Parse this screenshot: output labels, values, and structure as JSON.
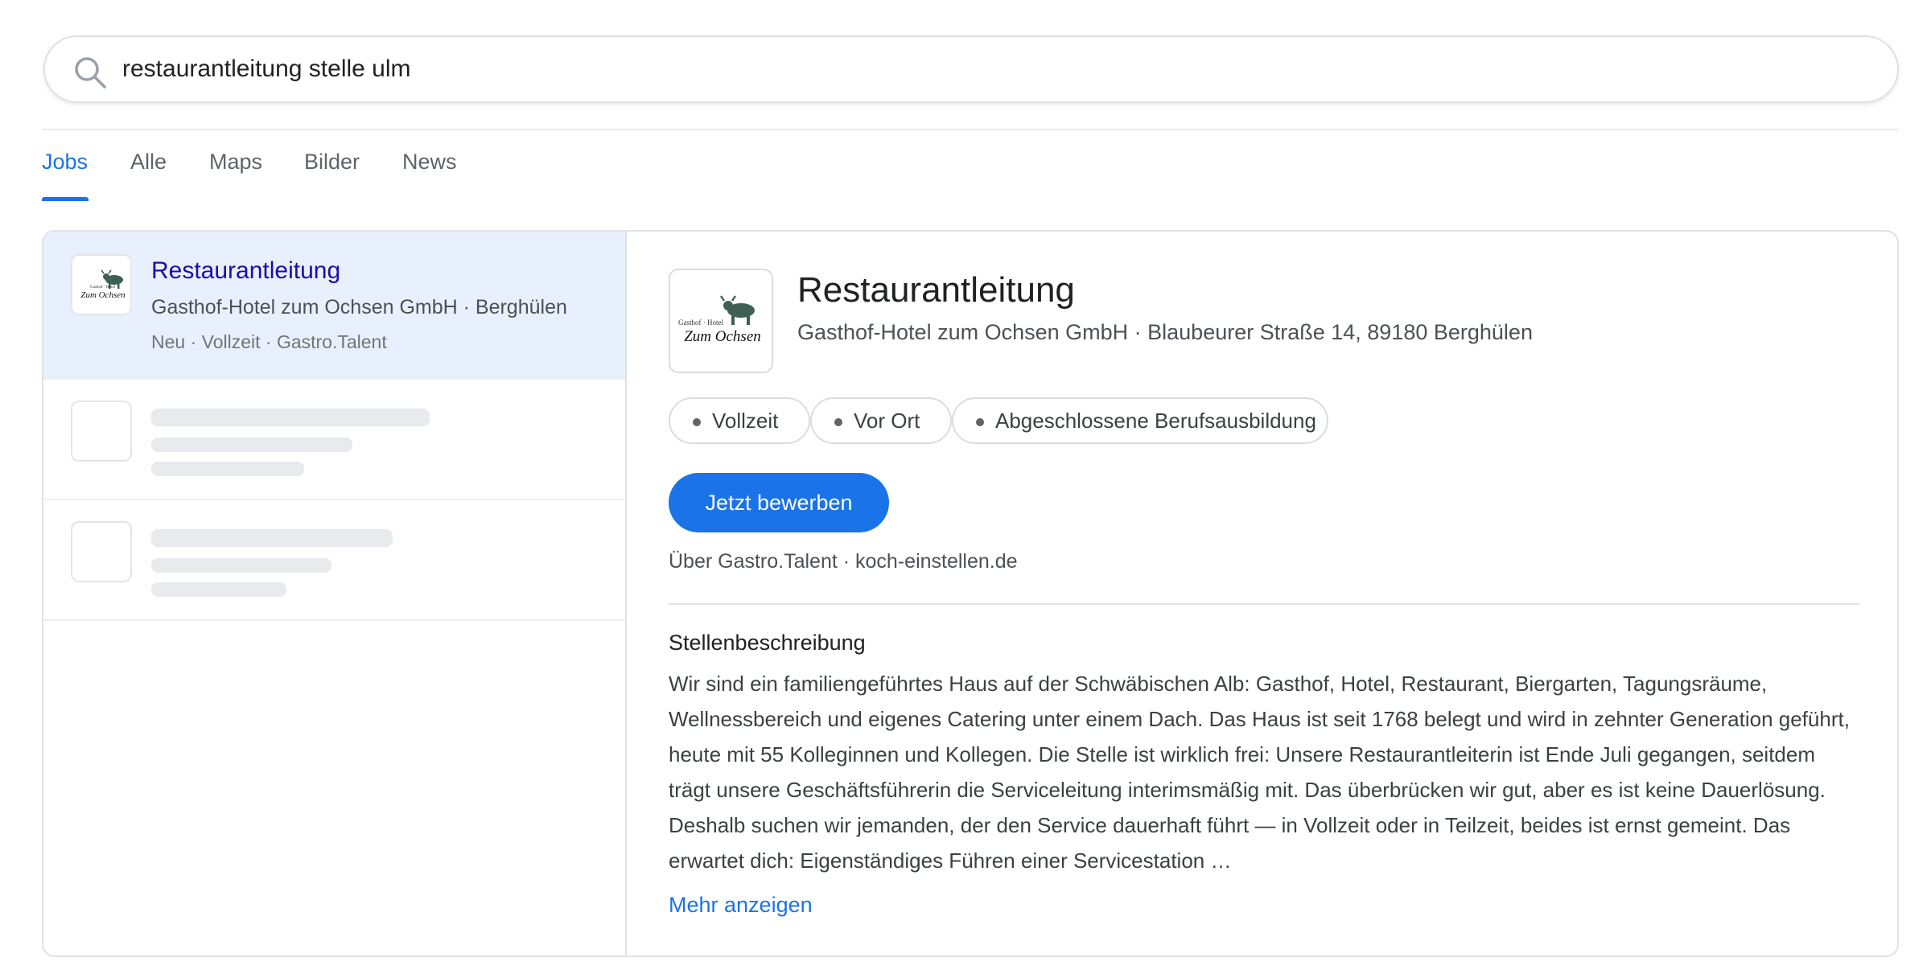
{
  "search": {
    "query": "restaurantleitung stelle ulm",
    "icon": "search-icon"
  },
  "tabs": [
    {
      "label": "Jobs",
      "active": true
    },
    {
      "label": "Alle",
      "active": false
    },
    {
      "label": "Maps",
      "active": false
    },
    {
      "label": "Bilder",
      "active": false
    },
    {
      "label": "News",
      "active": false
    }
  ],
  "job_list": {
    "selected": {
      "title": "Restaurantleitung",
      "company_location": "Gasthof-Hotel zum Ochsen GmbH · Berghülen",
      "meta": "Neu · Vollzeit · Gastro.Talent"
    }
  },
  "logo": {
    "small_text": "Gasthof · Hotel",
    "name": "Zum Ochsen"
  },
  "detail": {
    "title": "Restaurantleitung",
    "company_address": "Gasthof-Hotel zum Ochsen GmbH · Blaubeurer Straße 14, 89180 Berghülen",
    "chips": [
      "Vollzeit",
      "Vor Ort",
      "Abgeschlossene Berufsausbildung"
    ],
    "apply_label": "Jetzt bewerben",
    "via": "Über Gastro.Talent · koch-einstellen.de",
    "description_heading": "Stellenbeschreibung",
    "description": "Wir sind ein familiengeführtes Haus auf der Schwäbischen Alb: Gasthof, Hotel, Restaurant, Biergarten, Tagungsräume, Wellnessbereich und eigenes Catering unter einem Dach. Das Haus ist seit 1768 belegt und wird in zehnter Generation geführt, heute mit 55 Kolleginnen und Kollegen. Die Stelle ist wirklich frei: Unsere Restaurantleiterin ist Ende Juli gegangen, seitdem trägt unsere Geschäftsführerin die Serviceleitung interimsmäßig mit. Das überbrücken wir gut, aber es ist keine Dauerlösung. Deshalb suchen wir jemanden, der den Service dauerhaft führt — in Vollzeit oder in Teilzeit, beides ist ernst gemeint. Das erwartet dich: Eigenständiges Führen einer Servicestation …",
    "more_label": "Mehr anzeigen"
  },
  "colors": {
    "accent": "#1a73e8",
    "link_title": "#1a0dab",
    "selected_bg": "#e8f0fe",
    "logo_bull": "#3f5f55"
  }
}
